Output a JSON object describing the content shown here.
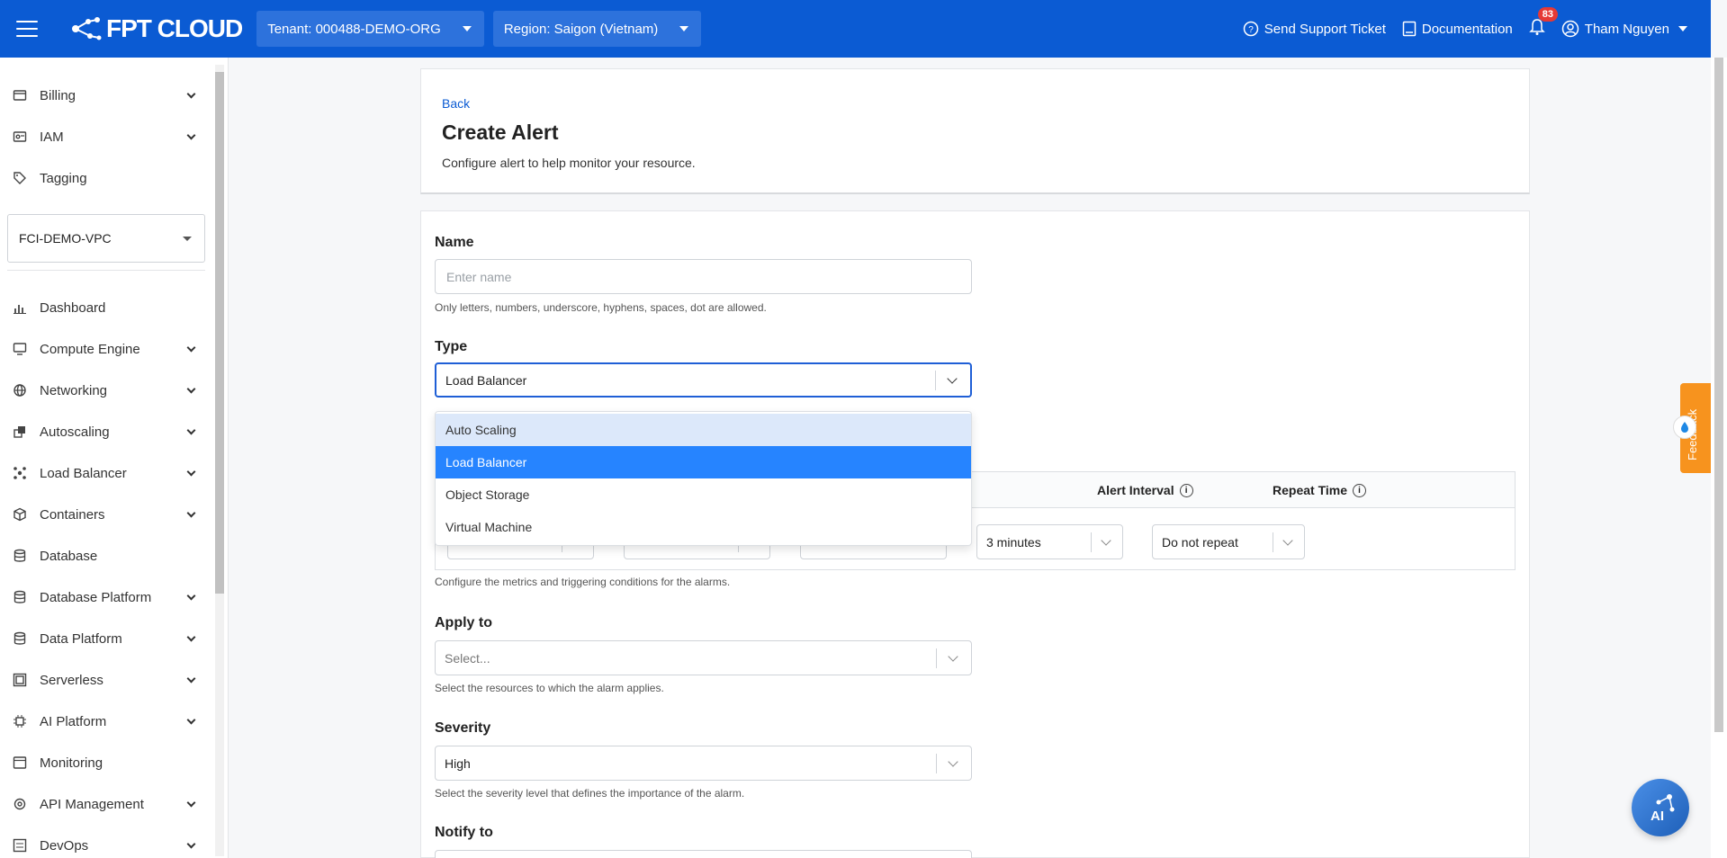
{
  "header": {
    "brand": "FPT CLOUD",
    "tenant": "Tenant: 000488-DEMO-ORG",
    "region": "Region: Saigon (Vietnam)",
    "support": "Send Support Ticket",
    "docs": "Documentation",
    "notifications": "83",
    "user": "Tham Nguyen"
  },
  "sidebar": {
    "top_items": [
      {
        "label": "Billing",
        "icon": "billing-icon",
        "expandable": true
      },
      {
        "label": "IAM",
        "icon": "iam-icon",
        "expandable": true
      },
      {
        "label": "Tagging",
        "icon": "tag-icon",
        "expandable": false
      }
    ],
    "vpc": "FCI-DEMO-VPC",
    "items": [
      {
        "label": "Dashboard",
        "icon": "chart-icon",
        "expandable": false
      },
      {
        "label": "Compute Engine",
        "icon": "monitor-icon",
        "expandable": true
      },
      {
        "label": "Networking",
        "icon": "globe-icon",
        "expandable": true
      },
      {
        "label": "Autoscaling",
        "icon": "autoscaling-icon",
        "expandable": true
      },
      {
        "label": "Load Balancer",
        "icon": "load-balancer-icon",
        "expandable": true
      },
      {
        "label": "Containers",
        "icon": "cube-icon",
        "expandable": true
      },
      {
        "label": "Database",
        "icon": "database-icon",
        "expandable": false
      },
      {
        "label": "Database Platform",
        "icon": "database-icon",
        "expandable": true
      },
      {
        "label": "Data Platform",
        "icon": "database-icon",
        "expandable": true
      },
      {
        "label": "Serverless",
        "icon": "serverless-icon",
        "expandable": true
      },
      {
        "label": "AI Platform",
        "icon": "chip-icon",
        "expandable": true
      },
      {
        "label": "Monitoring",
        "icon": "monitoring-icon",
        "expandable": false
      },
      {
        "label": "API Management",
        "icon": "api-icon",
        "expandable": true
      },
      {
        "label": "DevOps",
        "icon": "devops-icon",
        "expandable": true
      }
    ]
  },
  "page": {
    "back": "Back",
    "title": "Create Alert",
    "subtitle": "Configure alert to help monitor your resource."
  },
  "form": {
    "name_label": "Name",
    "name_placeholder": "Enter name",
    "name_help": "Only letters, numbers, underscore, hyphens, spaces, dot are allowed.",
    "type_label": "Type",
    "type_value": "Load Balancer",
    "type_options": [
      "Auto Scaling",
      "Load Balancer",
      "Object Storage",
      "Virtual Machine"
    ],
    "alert_interval_header": "Alert Interval",
    "repeat_time_header": "Repeat Time",
    "alert_interval_value": "3 minutes",
    "repeat_time_value": "Do not repeat",
    "conditions_help": "Configure the metrics and triggering conditions for the alarms.",
    "apply_label": "Apply to",
    "apply_placeholder": "Select...",
    "apply_help": "Select the resources to which the alarm applies.",
    "severity_label": "Severity",
    "severity_value": "High",
    "severity_help": "Select the severity level that defines the importance of the alarm.",
    "notify_label": "Notify to"
  },
  "feedback": "Feedback",
  "ai_button": "AI",
  "colors": {
    "header": "#0b5bd3",
    "accent": "#2684ff",
    "feedback": "#f7931e"
  }
}
